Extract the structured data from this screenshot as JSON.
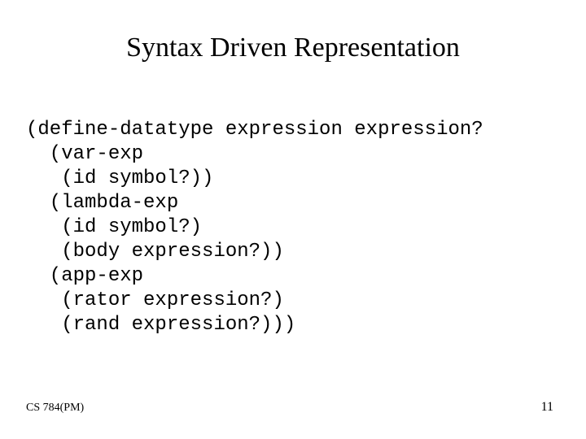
{
  "title": "Syntax Driven Representation",
  "code": "(define-datatype expression expression?\n  (var-exp\n   (id symbol?))\n  (lambda-exp\n   (id symbol?)\n   (body expression?))\n  (app-exp\n   (rator expression?)\n   (rand expression?)))",
  "footer": {
    "left": "CS 784(PM)",
    "right": "11"
  }
}
